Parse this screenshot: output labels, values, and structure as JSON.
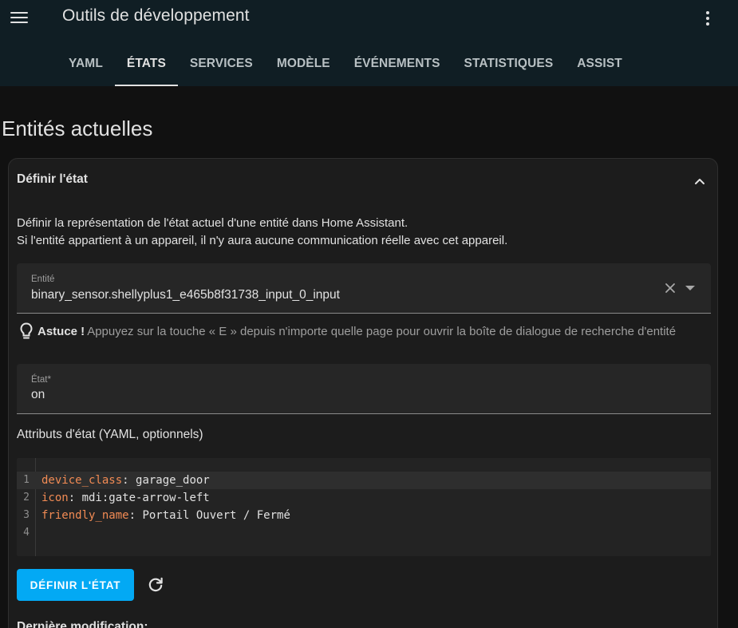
{
  "header": {
    "title": "Outils de développement",
    "tabs": [
      {
        "label": "YAML"
      },
      {
        "label": "ÉTATS"
      },
      {
        "label": "SERVICES"
      },
      {
        "label": "MODÈLE"
      },
      {
        "label": "ÉVÉNEMENTS"
      },
      {
        "label": "STATISTIQUES"
      },
      {
        "label": "ASSIST"
      }
    ],
    "active_tab": "ÉTATS"
  },
  "page": {
    "heading": "Entités actuelles"
  },
  "card": {
    "title": "Définir l'état",
    "description_line1": "Définir la représentation de l'état actuel d'une entité dans Home Assistant.",
    "description_line2": "Si l'entité appartient à un appareil, il n'y aura aucune communication réelle avec cet appareil.",
    "entity_field": {
      "label": "Entité",
      "value": "binary_sensor.shellyplus1_e465b8f31738_input_0_input"
    },
    "tip": {
      "prefix": "Astuce !",
      "text": "Appuyez sur la touche « E » depuis n'importe quelle page pour ouvrir la boîte de dialogue de recherche d'entité"
    },
    "state_field": {
      "label": "État*",
      "value": "on"
    },
    "attributes_label": "Attributs d'état (YAML, optionnels)",
    "code_lines": [
      {
        "num": "1",
        "key": "device_class",
        "sep": ": ",
        "value": "garage_door"
      },
      {
        "num": "2",
        "key": "icon",
        "sep": ": ",
        "value": "mdi:gate-arrow-left"
      },
      {
        "num": "3",
        "key": "friendly_name",
        "sep": ": ",
        "value": "Portail Ouvert / Fermé"
      },
      {
        "num": "4",
        "key": "",
        "sep": "",
        "value": ""
      }
    ],
    "set_button": "DÉFINIR L'ÉTAT",
    "last_modified_label": "Dernière modification:"
  },
  "colors": {
    "header_bg": "#101e24",
    "accent": "#03a9f4",
    "yaml_key": "#f28b54"
  },
  "icons": [
    "menu-icon",
    "more-vertical-icon",
    "chevron-up-icon",
    "close-icon",
    "dropdown-arrow-icon",
    "lightbulb-icon",
    "refresh-icon"
  ]
}
